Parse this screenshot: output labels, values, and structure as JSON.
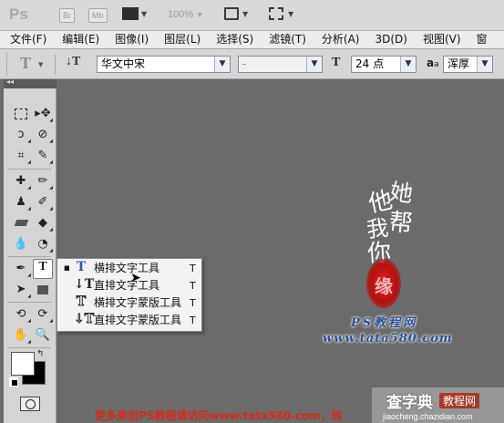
{
  "appbar": {
    "logo": "Ps",
    "bridge": "Br",
    "minibridge": "Mb",
    "zoom": "100%",
    "icons": [
      "screen-layout-icon",
      "arrange-documents-icon",
      "screen-mode-icon"
    ]
  },
  "menubar": {
    "items": [
      "文件(F)",
      "编辑(E)",
      "图像(I)",
      "图层(L)",
      "选择(S)",
      "滤镜(T)",
      "分析(A)",
      "3D(D)",
      "视图(V)",
      "窗"
    ]
  },
  "options": {
    "tool_glyph": "T",
    "font_family": "华文中宋",
    "font_style": "-",
    "font_size": "24 点",
    "aa_label": "a",
    "aa_label_small": "a",
    "antialias": "浑厚"
  },
  "flyout": {
    "items": [
      {
        "label": "横排文字工具",
        "key": "T",
        "icon": "horizontal-type-icon",
        "selected": true
      },
      {
        "label": "直排文字工具",
        "key": "T",
        "icon": "vertical-type-icon",
        "selected": false
      },
      {
        "label": "横排文字蒙版工具",
        "key": "T",
        "icon": "horizontal-type-mask-icon",
        "selected": false
      },
      {
        "label": "直排文字蒙版工具",
        "key": "T",
        "icon": "vertical-type-mask-icon",
        "selected": false
      }
    ]
  },
  "canvas": {
    "calligraphy_chars": [
      "他",
      "她",
      "我",
      "帮",
      "你"
    ],
    "seal_text": "缘",
    "brand_line": "PS教程网",
    "url_line": "www.tata580.com",
    "footer_text": "更多原创PS教程请访问www.tata580.com，转",
    "watermark_main": "查字典",
    "watermark_sub": "教程网",
    "watermark_url": "jiaocheng.chazidian.com"
  },
  "colors": {
    "app_bg": "#6b6b6b",
    "footer_text": "#d42a1a",
    "brand_text": "#2f4f8f",
    "seal": "#c21616"
  }
}
